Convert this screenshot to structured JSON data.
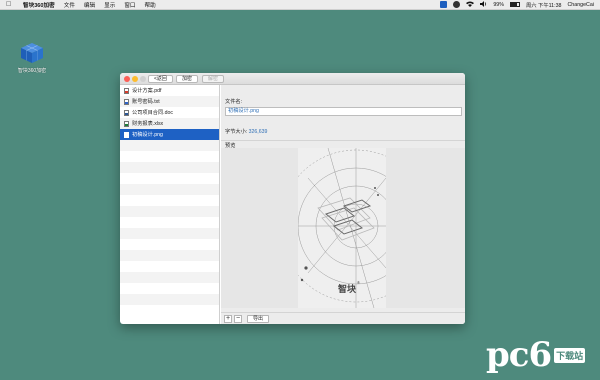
{
  "menubar": {
    "app_name": "智块360加密",
    "items": [
      "文件",
      "编辑",
      "显示",
      "窗口",
      "帮助"
    ],
    "status": {
      "battery": "99%",
      "clock": "周六 下午11:38",
      "user": "ChangeCai"
    }
  },
  "desktop": {
    "icon_label": "智块360加密"
  },
  "toolbar": {
    "back_label": "<返回",
    "encrypt_label": "加密",
    "decrypt_label": "解密"
  },
  "files": [
    {
      "name": "设计方案.pdf",
      "type": "pdf"
    },
    {
      "name": "账号密码.txt",
      "type": "txt"
    },
    {
      "name": "公司项目合同.doc",
      "type": "doc"
    },
    {
      "name": "财务报表.xlsx",
      "type": "xls"
    },
    {
      "name": "初稿设计.png",
      "type": "png",
      "selected": true
    }
  ],
  "detail": {
    "filename_label": "文件名:",
    "filename_value": "初稿设计.png",
    "size_label": "字节大小:",
    "size_value": "326,639",
    "preview_label": "预览",
    "preview_text": "智块",
    "preview_mark": "®"
  },
  "bottom": {
    "add_label": "+",
    "remove_label": "−",
    "export_label": "导出"
  },
  "watermark": {
    "brand": "pc6",
    "site": "下载站"
  },
  "colors": {
    "desktop": "#4e8a7d",
    "selection": "#1e61c4",
    "value_text": "#2f6fb5"
  }
}
